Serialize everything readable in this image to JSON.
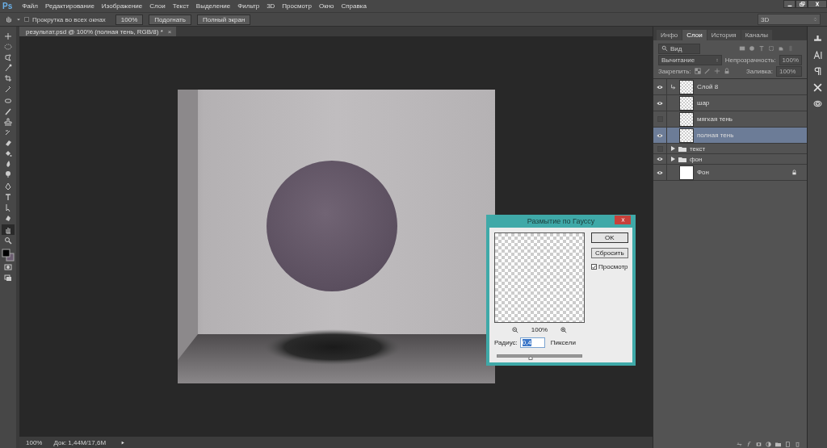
{
  "app": {
    "logo": "Ps",
    "menu": [
      "Файл",
      "Редактирование",
      "Изображение",
      "Слои",
      "Текст",
      "Выделение",
      "Фильтр",
      "3D",
      "Просмотр",
      "Окно",
      "Справка"
    ]
  },
  "options_bar": {
    "scroll_all": {
      "label": "Прокрутка во всех окнах",
      "checked": false
    },
    "buttons": [
      "100%",
      "Подогнать",
      "Полный экран"
    ],
    "workspace": "3D"
  },
  "tools": [
    {
      "selected": false
    },
    {
      "selected": false
    },
    {
      "selected": false
    },
    {
      "selected": false
    },
    {
      "selected": false
    },
    {
      "selected": false
    },
    {
      "selected": false
    },
    {
      "selected": false
    },
    {
      "selected": false
    },
    {
      "selected": false
    },
    {
      "selected": false
    },
    {
      "selected": false
    },
    {
      "selected": false
    },
    {
      "selected": false
    },
    {
      "selected": false
    },
    {
      "selected": false
    },
    {
      "selected": false
    },
    {
      "selected": false
    },
    {
      "selected": true
    },
    {
      "selected": false
    }
  ],
  "document": {
    "tab": "результат.psd @ 100% (полная тень, RGB/8) *",
    "close": "×",
    "zoom": "100%",
    "doc_size": "Док: 1,44М/17,6М"
  },
  "panel": {
    "tabs": [
      {
        "label": "Инфо",
        "selected": false
      },
      {
        "label": "Слои",
        "selected": true
      },
      {
        "label": "История",
        "selected": false
      },
      {
        "label": "Каналы",
        "selected": false
      }
    ],
    "filter": "Вид",
    "blend_mode": "Вычитание",
    "opacity_label": "Непрозрачность:",
    "opacity": "100%",
    "lock_label": "Закрепить:",
    "fill_label": "Заливка:",
    "fill": "100%",
    "layers": [
      {
        "name": "Слой 8",
        "kind": "layer",
        "visible": true,
        "selected": false,
        "clipped": true,
        "locked": false
      },
      {
        "name": "шар",
        "kind": "layer",
        "visible": true,
        "selected": false,
        "clipped": false,
        "locked": false
      },
      {
        "name": "мягкая тень",
        "kind": "layer",
        "visible": false,
        "selected": false,
        "clipped": false,
        "locked": false
      },
      {
        "name": "полная тень",
        "kind": "layer",
        "visible": true,
        "selected": true,
        "clipped": false,
        "locked": false
      },
      {
        "name": "текст",
        "kind": "group",
        "visible": false,
        "selected": false,
        "clipped": false,
        "locked": false
      },
      {
        "name": "фон",
        "kind": "group",
        "visible": true,
        "selected": false,
        "clipped": false,
        "locked": false
      },
      {
        "name": "Фон",
        "kind": "layer",
        "visible": true,
        "selected": false,
        "clipped": false,
        "locked": true
      }
    ]
  },
  "dialog": {
    "title": "Размытие по Гауссу",
    "buttons": [
      "OK",
      "Сбросить"
    ],
    "preview": {
      "label": "Просмотр",
      "checked": true
    },
    "zoom": "100%",
    "radius": {
      "label": "Радиус:",
      "value": "0,4",
      "unit": "Пиксели",
      "level": 0.39
    }
  }
}
